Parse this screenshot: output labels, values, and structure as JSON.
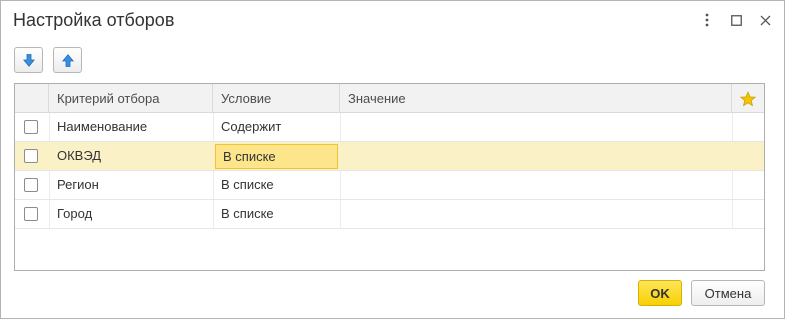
{
  "window": {
    "title": "Настройка отборов"
  },
  "toolbar": {
    "move_down_icon": "arrow-down-icon",
    "move_up_icon": "arrow-up-icon"
  },
  "table": {
    "columns": [
      "Критерий отбора",
      "Условие",
      "Значение"
    ],
    "favorite_icon": "star-icon",
    "rows": [
      {
        "checked": false,
        "criterion": "Наименование",
        "condition": "Содержит",
        "value": "",
        "selected": false
      },
      {
        "checked": false,
        "criterion": "ОКВЭД",
        "condition": "В списке",
        "value": "",
        "selected": true
      },
      {
        "checked": false,
        "criterion": "Регион",
        "condition": "В списке",
        "value": "",
        "selected": false
      },
      {
        "checked": false,
        "criterion": "Город",
        "condition": "В списке",
        "value": "",
        "selected": false
      }
    ]
  },
  "footer": {
    "ok_label": "OK",
    "cancel_label": "Отмена"
  },
  "colors": {
    "accent": "#f7d000",
    "selected_row": "#fbf1c6",
    "active_cell": "#fce58b",
    "toolbar_arrow": "#3b8ede",
    "star": "#f5c400"
  }
}
